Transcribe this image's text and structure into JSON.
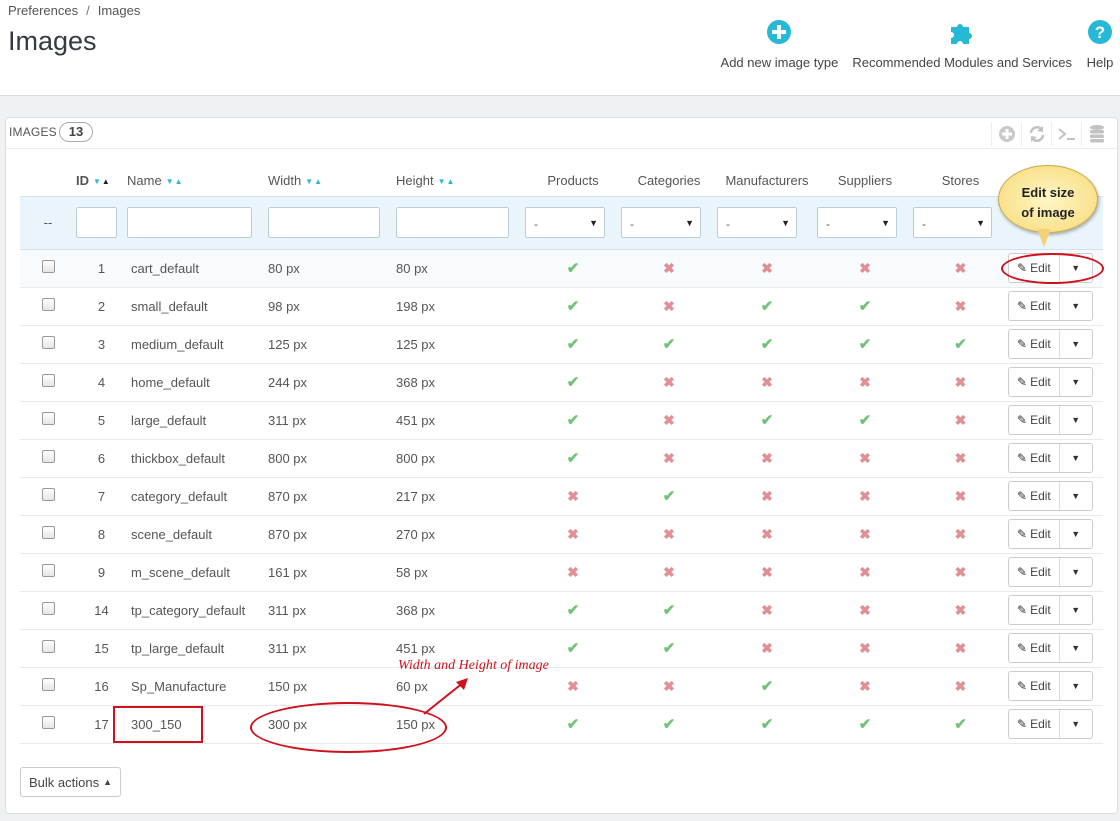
{
  "breadcrumb": {
    "parent": "Preferences",
    "separator": "/",
    "current": "Images"
  },
  "page_title": "Images",
  "toolbar": [
    {
      "label": "Add new image type",
      "icon": "plus-circle-icon"
    },
    {
      "label": "Recommended Modules and Services",
      "icon": "puzzle-piece-icon"
    },
    {
      "label": "Help",
      "icon": "question-circle-icon"
    }
  ],
  "panel": {
    "title": "Images",
    "count": "13"
  },
  "columns": {
    "id": "ID",
    "name": "Name",
    "width": "Width",
    "height": "Height",
    "products": "Products",
    "categories": "Categories",
    "manufacturers": "Manufacturers",
    "suppliers": "Suppliers",
    "stores": "Stores"
  },
  "filters": {
    "id_placeholder": "--",
    "select_value": "-"
  },
  "rows": [
    {
      "id": "1",
      "name": "cart_default",
      "width": "80 px",
      "height": "80 px",
      "flags": [
        true,
        false,
        false,
        false,
        false
      ]
    },
    {
      "id": "2",
      "name": "small_default",
      "width": "98 px",
      "height": "198 px",
      "flags": [
        true,
        false,
        true,
        true,
        false
      ]
    },
    {
      "id": "3",
      "name": "medium_default",
      "width": "125 px",
      "height": "125 px",
      "flags": [
        true,
        true,
        true,
        true,
        true
      ]
    },
    {
      "id": "4",
      "name": "home_default",
      "width": "244 px",
      "height": "368 px",
      "flags": [
        true,
        false,
        false,
        false,
        false
      ]
    },
    {
      "id": "5",
      "name": "large_default",
      "width": "311 px",
      "height": "451 px",
      "flags": [
        true,
        false,
        true,
        true,
        false
      ]
    },
    {
      "id": "6",
      "name": "thickbox_default",
      "width": "800 px",
      "height": "800 px",
      "flags": [
        true,
        false,
        false,
        false,
        false
      ]
    },
    {
      "id": "7",
      "name": "category_default",
      "width": "870 px",
      "height": "217 px",
      "flags": [
        false,
        true,
        false,
        false,
        false
      ]
    },
    {
      "id": "8",
      "name": "scene_default",
      "width": "870 px",
      "height": "270 px",
      "flags": [
        false,
        false,
        false,
        false,
        false
      ]
    },
    {
      "id": "9",
      "name": "m_scene_default",
      "width": "161 px",
      "height": "58 px",
      "flags": [
        false,
        false,
        false,
        false,
        false
      ]
    },
    {
      "id": "14",
      "name": "tp_category_default",
      "width": "311 px",
      "height": "368 px",
      "flags": [
        true,
        true,
        false,
        false,
        false
      ]
    },
    {
      "id": "15",
      "name": "tp_large_default",
      "width": "311 px",
      "height": "451 px",
      "flags": [
        true,
        true,
        false,
        false,
        false
      ]
    },
    {
      "id": "16",
      "name": "Sp_Manufacture",
      "width": "150 px",
      "height": "60 px",
      "flags": [
        false,
        false,
        true,
        false,
        false
      ]
    },
    {
      "id": "17",
      "name": "300_150",
      "width": "300 px",
      "height": "150 px",
      "flags": [
        true,
        true,
        true,
        true,
        true
      ]
    }
  ],
  "row_action": {
    "edit_label": "Edit"
  },
  "bulk_actions_label": "Bulk actions",
  "annotations": {
    "callout_line1": "Edit size",
    "callout_line2": "of image",
    "width_height_note": "Width and Height of image"
  },
  "colors": {
    "yes": "#72c279",
    "no": "#e08f95",
    "accent": "#25b9d7",
    "annotation": "#d0101c"
  }
}
